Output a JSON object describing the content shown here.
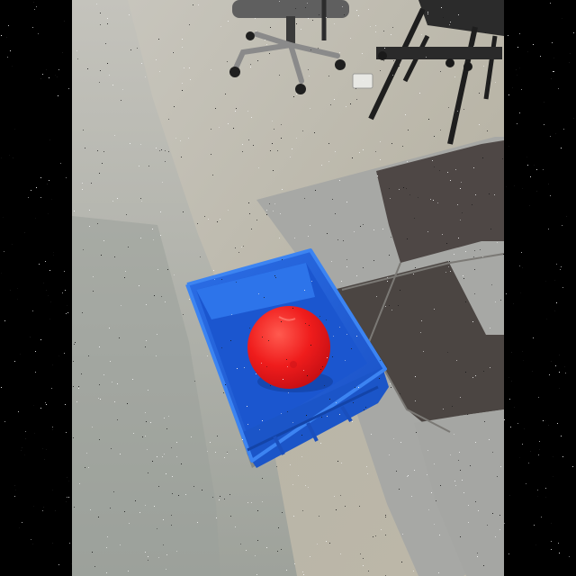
{
  "image": {
    "subject": "red-ball-in-blue-bin",
    "colors": {
      "letterbox": "#000000",
      "floor": "#b7b3a6",
      "floor_dark_edge": "#8d8f86",
      "mat_light": "#a9a9a7",
      "mat_dark": "#4b4542",
      "bin_blue": "#1f62d9",
      "bin_blue_dark": "#1749b6",
      "ball_red": "#ef1c1c",
      "chair_dark": "#2d2d2d",
      "chair_gray": "#6f6f6f"
    }
  }
}
